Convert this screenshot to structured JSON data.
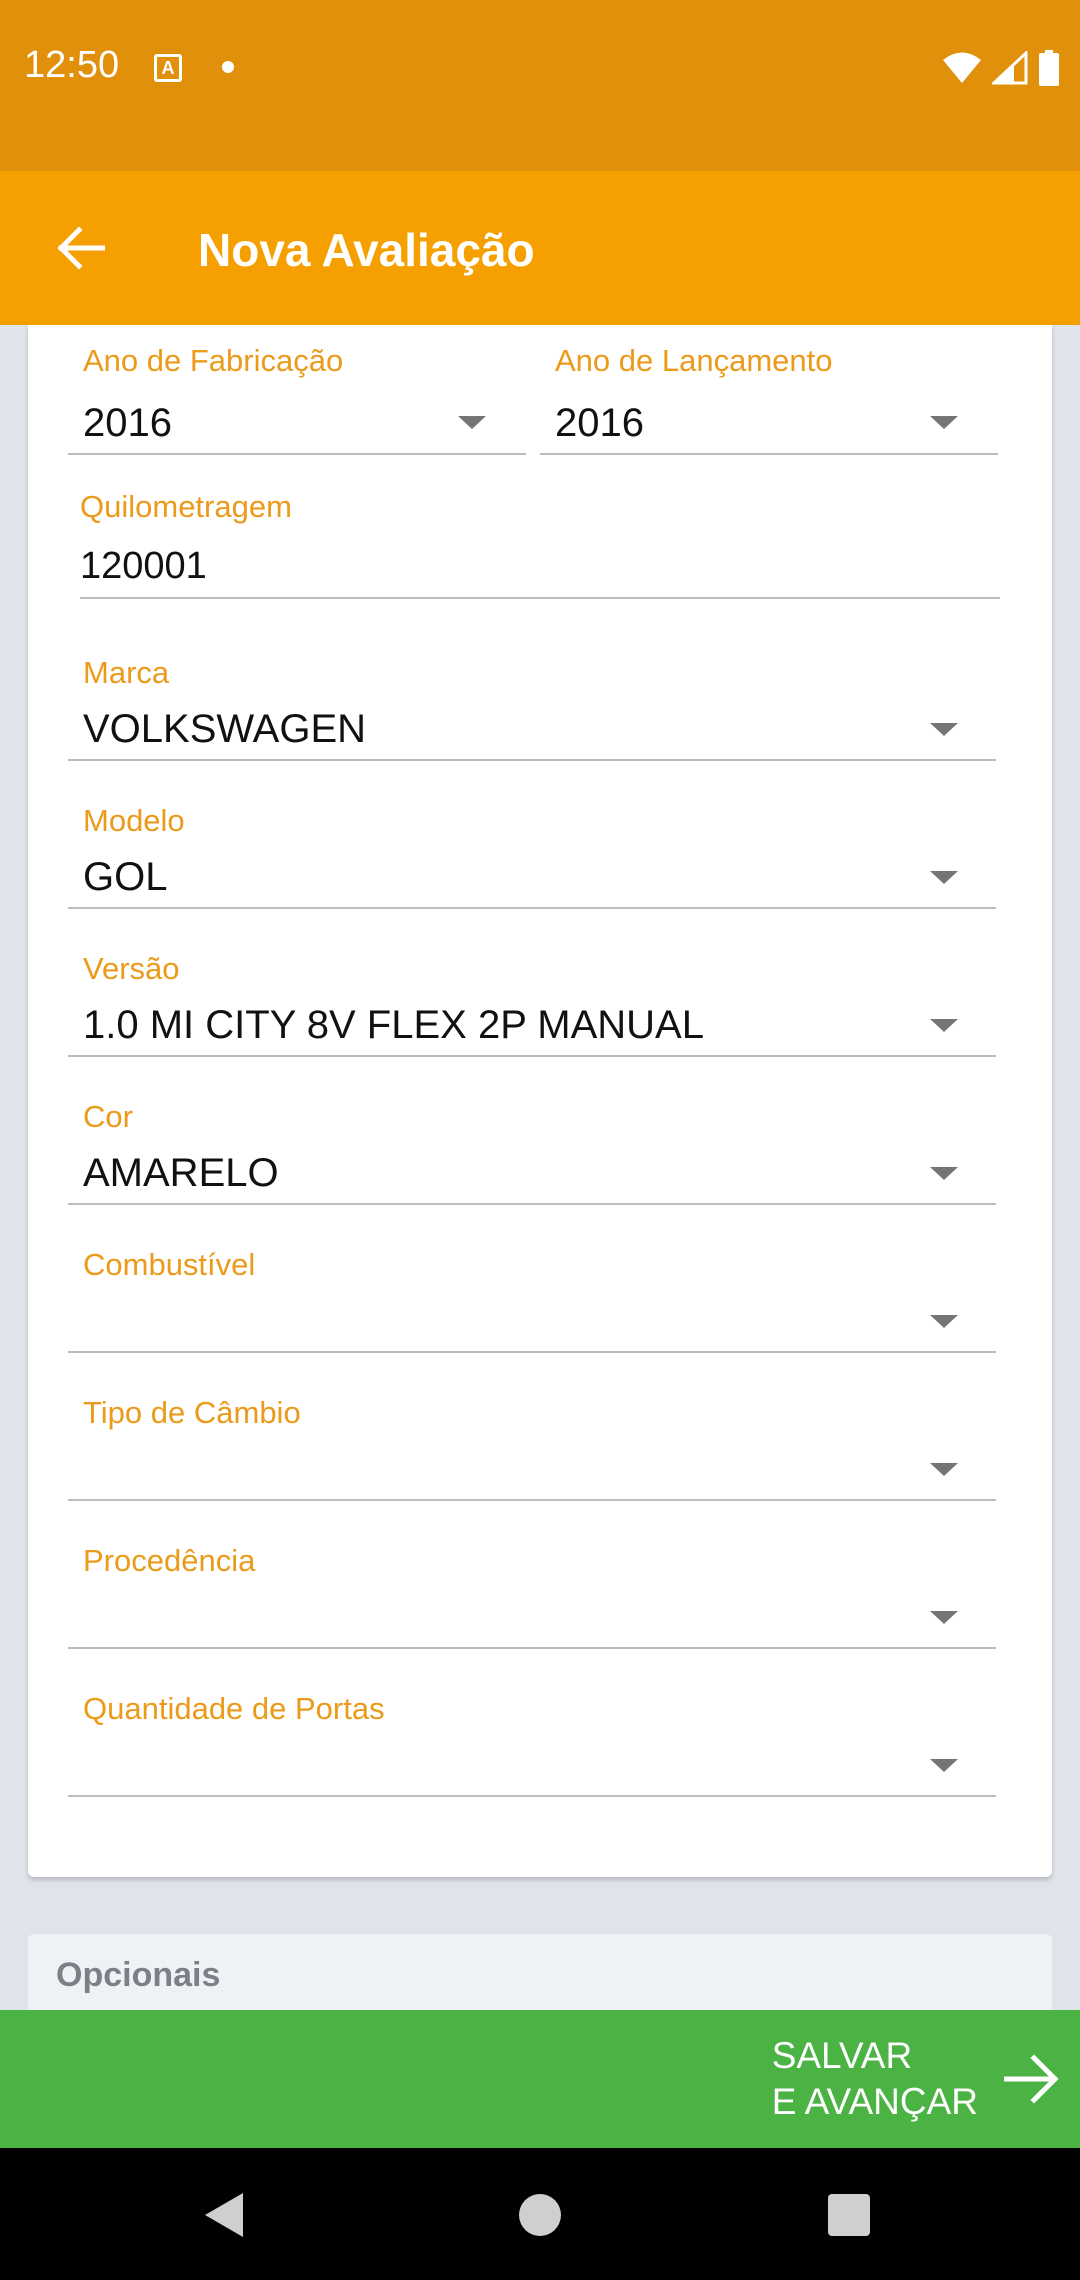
{
  "status_bar": {
    "time": "12:50",
    "notif_icon_letter": "A"
  },
  "app_bar": {
    "title": "Nova Avaliação"
  },
  "form": {
    "ano_fabricacao": {
      "label": "Ano de Fabricação",
      "value": "2016"
    },
    "ano_lancamento": {
      "label": "Ano de Lançamento",
      "value": "2016"
    },
    "quilometragem": {
      "label": "Quilometragem",
      "value": "120001"
    },
    "marca": {
      "label": "Marca",
      "value": "VOLKSWAGEN"
    },
    "modelo": {
      "label": "Modelo",
      "value": "GOL"
    },
    "versao": {
      "label": "Versão",
      "value": "1.0 MI CITY 8V FLEX 2P MANUAL"
    },
    "cor": {
      "label": "Cor",
      "value": "AMARELO"
    },
    "combustivel": {
      "label": "Combustível",
      "value": ""
    },
    "tipo_cambio": {
      "label": "Tipo de Câmbio",
      "value": ""
    },
    "procedencia": {
      "label": "Procedência",
      "value": ""
    },
    "quantidade_portas": {
      "label": "Quantidade de Portas",
      "value": ""
    }
  },
  "opcionais": {
    "label": "Opcionais"
  },
  "save_button": {
    "line1": "SALVAR",
    "line2": "E AVANÇAR"
  },
  "colors": {
    "status_bar": "#e0900a",
    "app_bar": "#f5a000",
    "label": "#eb9a1a",
    "save_bar": "#4bb244",
    "background": "#dfe4ea"
  }
}
